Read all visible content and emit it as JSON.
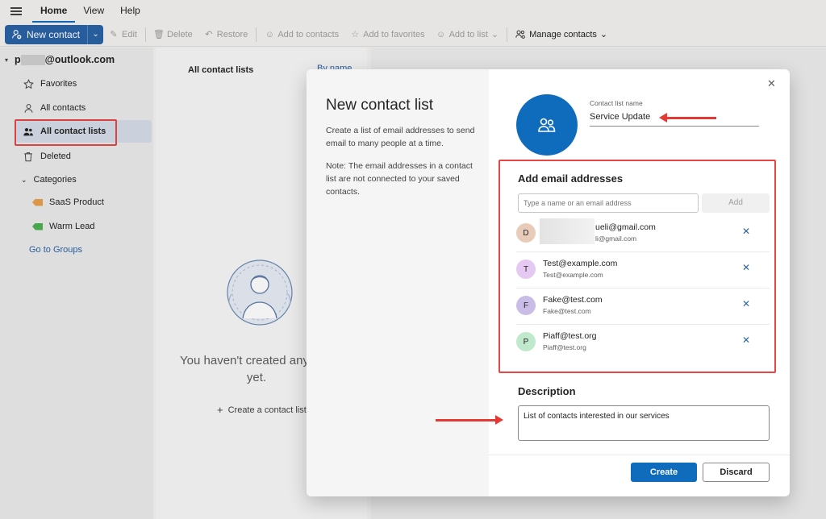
{
  "nav": {
    "tabs": [
      "Home",
      "View",
      "Help"
    ],
    "active": "Home"
  },
  "ribbon": {
    "new_contact": "New contact",
    "edit": "Edit",
    "delete": "Delete",
    "restore": "Restore",
    "add_to_contacts": "Add to contacts",
    "add_to_favorites": "Add to favorites",
    "add_to_list": "Add to list",
    "manage_contacts": "Manage contacts"
  },
  "sidebar": {
    "account_prefix": "p",
    "account_suffix": "@outlook.com",
    "items": [
      {
        "label": "Favorites",
        "icon": "star-icon"
      },
      {
        "label": "All contacts",
        "icon": "person-icon"
      },
      {
        "label": "All contact lists",
        "icon": "people-icon"
      },
      {
        "label": "Deleted",
        "icon": "trash-icon"
      }
    ],
    "categories_label": "Categories",
    "categories": [
      {
        "label": "SaaS Product",
        "color": "#e8a04a"
      },
      {
        "label": "Warm Lead",
        "color": "#4caf50"
      }
    ],
    "go_to_groups": "Go to Groups"
  },
  "list_pane": {
    "header": "All contact lists",
    "sort": "By name",
    "empty_text": "You haven't created any lists yet.",
    "create_link": "Create a contact list"
  },
  "modal": {
    "title": "New contact list",
    "description": "Create a list of email addresses to send email to many people at a time.",
    "note": "Note: The email addresses in a contact list are not connected to your saved contacts.",
    "name_label": "Contact list name",
    "name_value": "Service Update",
    "add_heading": "Add email addresses",
    "add_placeholder": "Type a name or an email address",
    "add_button": "Add",
    "emails": [
      {
        "initial": "D",
        "name": "ueli@gmail.com",
        "email": "li@gmail.com",
        "color": "#e8cbb8"
      },
      {
        "initial": "T",
        "name": "Test@example.com",
        "email": "Test@example.com",
        "color": "#e5c9f2"
      },
      {
        "initial": "F",
        "name": "Fake@test.com",
        "email": "Fake@test.com",
        "color": "#c9bde8"
      },
      {
        "initial": "P",
        "name": "Piaff@test.org",
        "email": "Piaff@test.org",
        "color": "#bfe8cd"
      }
    ],
    "description_heading": "Description",
    "description_value": "List of contacts interested in our services",
    "create_button": "Create",
    "discard_button": "Discard"
  }
}
